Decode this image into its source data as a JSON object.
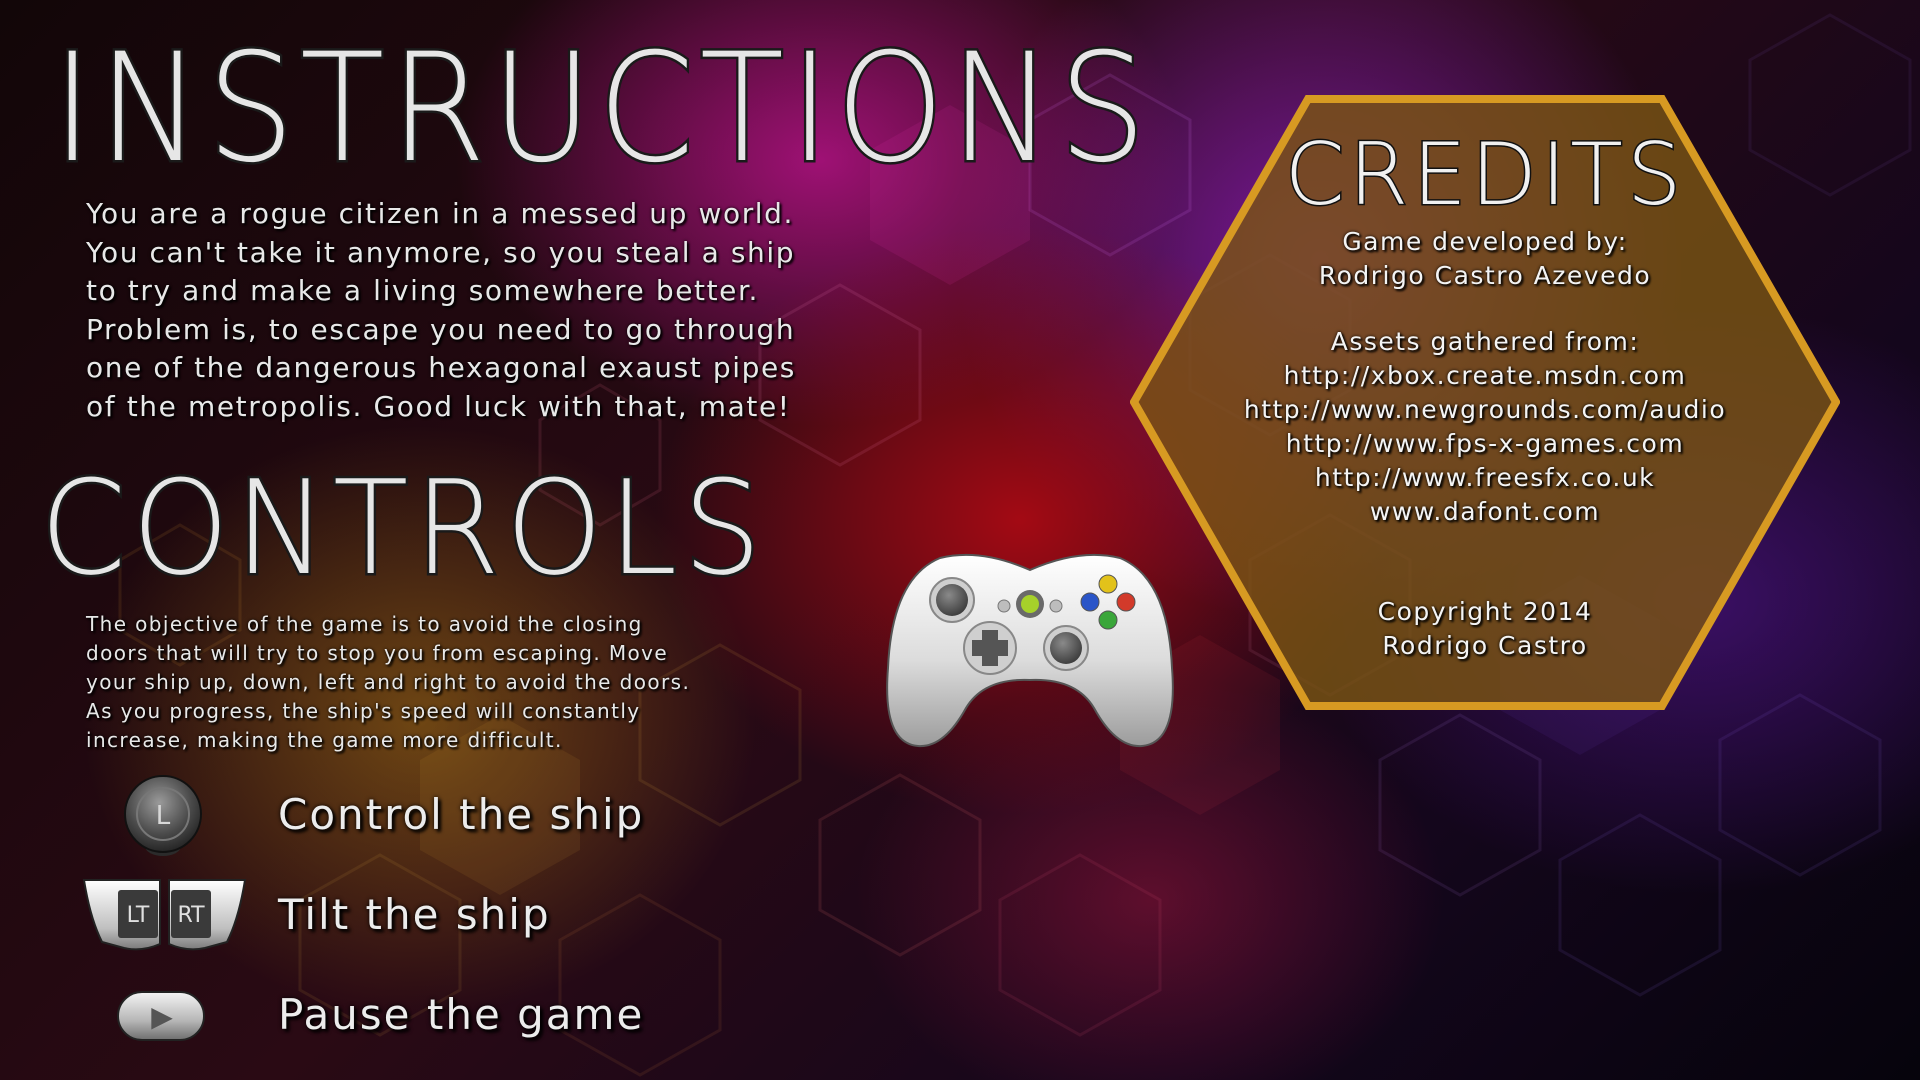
{
  "instructions": {
    "title": "Instructions",
    "text": "You are a rogue citizen in a messed up world.\nYou can't take it anymore, so you steal a ship\nto try and make a living somewhere better.\nProblem is, to escape you need to go through\none of the dangerous hexagonal exaust pipes\nof the metropolis. Good luck with that, mate!"
  },
  "controls": {
    "title": "Controls",
    "objective": "The objective of the game is to avoid the closing\ndoors that will try to stop you from escaping. Move\nyour ship up, down, left and right to avoid the doors.\nAs you progress, the ship's speed will constantly\nincrease, making the game more difficult.",
    "actions": [
      {
        "button": "L",
        "button_icon": "left-stick-icon",
        "label": "Control the ship"
      },
      {
        "button": "LT",
        "button2": "RT",
        "button_icon": "trigger-buttons-icon",
        "label": "Tilt the ship"
      },
      {
        "button": "▶",
        "button_icon": "start-button-icon",
        "label": "Pause the game"
      }
    ],
    "controller_icon": "xbox-controller-icon"
  },
  "credits": {
    "title": "Credits",
    "developed_by_label": "Game developed by:",
    "developer": "Rodrigo Castro Azevedo",
    "assets_label": "Assets gathered from:",
    "assets": [
      "http://xbox.create.msdn.com",
      "http://www.newgrounds.com/audio",
      "http://www.fps-x-games.com",
      "http://www.freesfx.co.uk",
      "www.dafont.com"
    ],
    "copyright": "Copyright 2014",
    "copyright_holder": "Rodrigo Castro"
  },
  "colors": {
    "credits_fill": "#7a5414",
    "credits_border": "#d79a22",
    "text": "#e8e8e8"
  }
}
